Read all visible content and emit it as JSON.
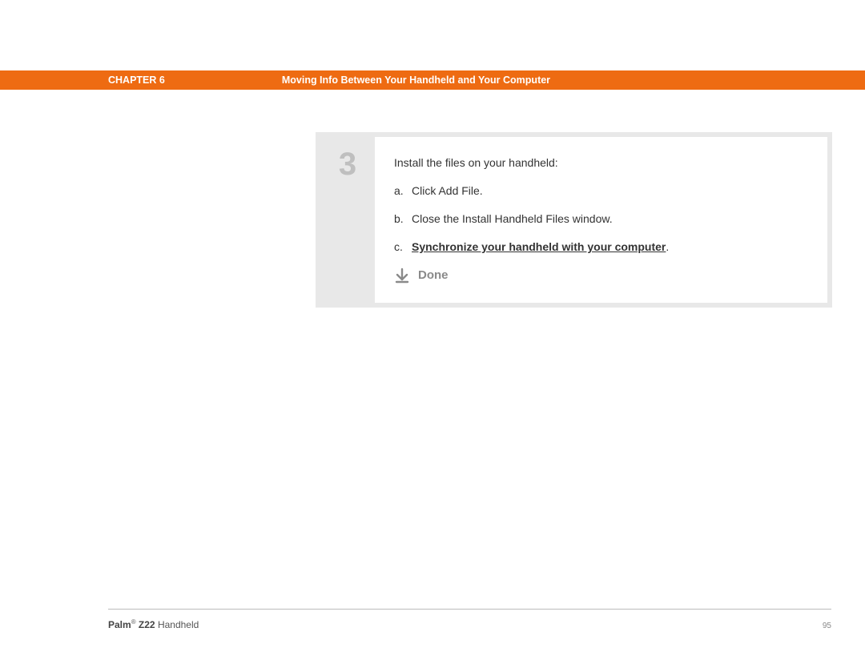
{
  "header": {
    "chapter_label": "CHAPTER 6",
    "title": "Moving Info Between Your Handheld and Your Computer"
  },
  "step": {
    "number": "3",
    "intro": "Install the files on your handheld:",
    "items": [
      {
        "letter": "a.",
        "text": "Click Add File.",
        "link": false
      },
      {
        "letter": "b.",
        "text": "Close the Install Handheld Files window.",
        "link": false
      },
      {
        "letter": "c.",
        "text": "Synchronize your handheld with your computer",
        "link": true,
        "suffix": "."
      }
    ],
    "done_label": "Done"
  },
  "footer": {
    "brand": "Palm",
    "reg": "®",
    "model": " Z22",
    "product": " Handheld",
    "page": "95"
  }
}
